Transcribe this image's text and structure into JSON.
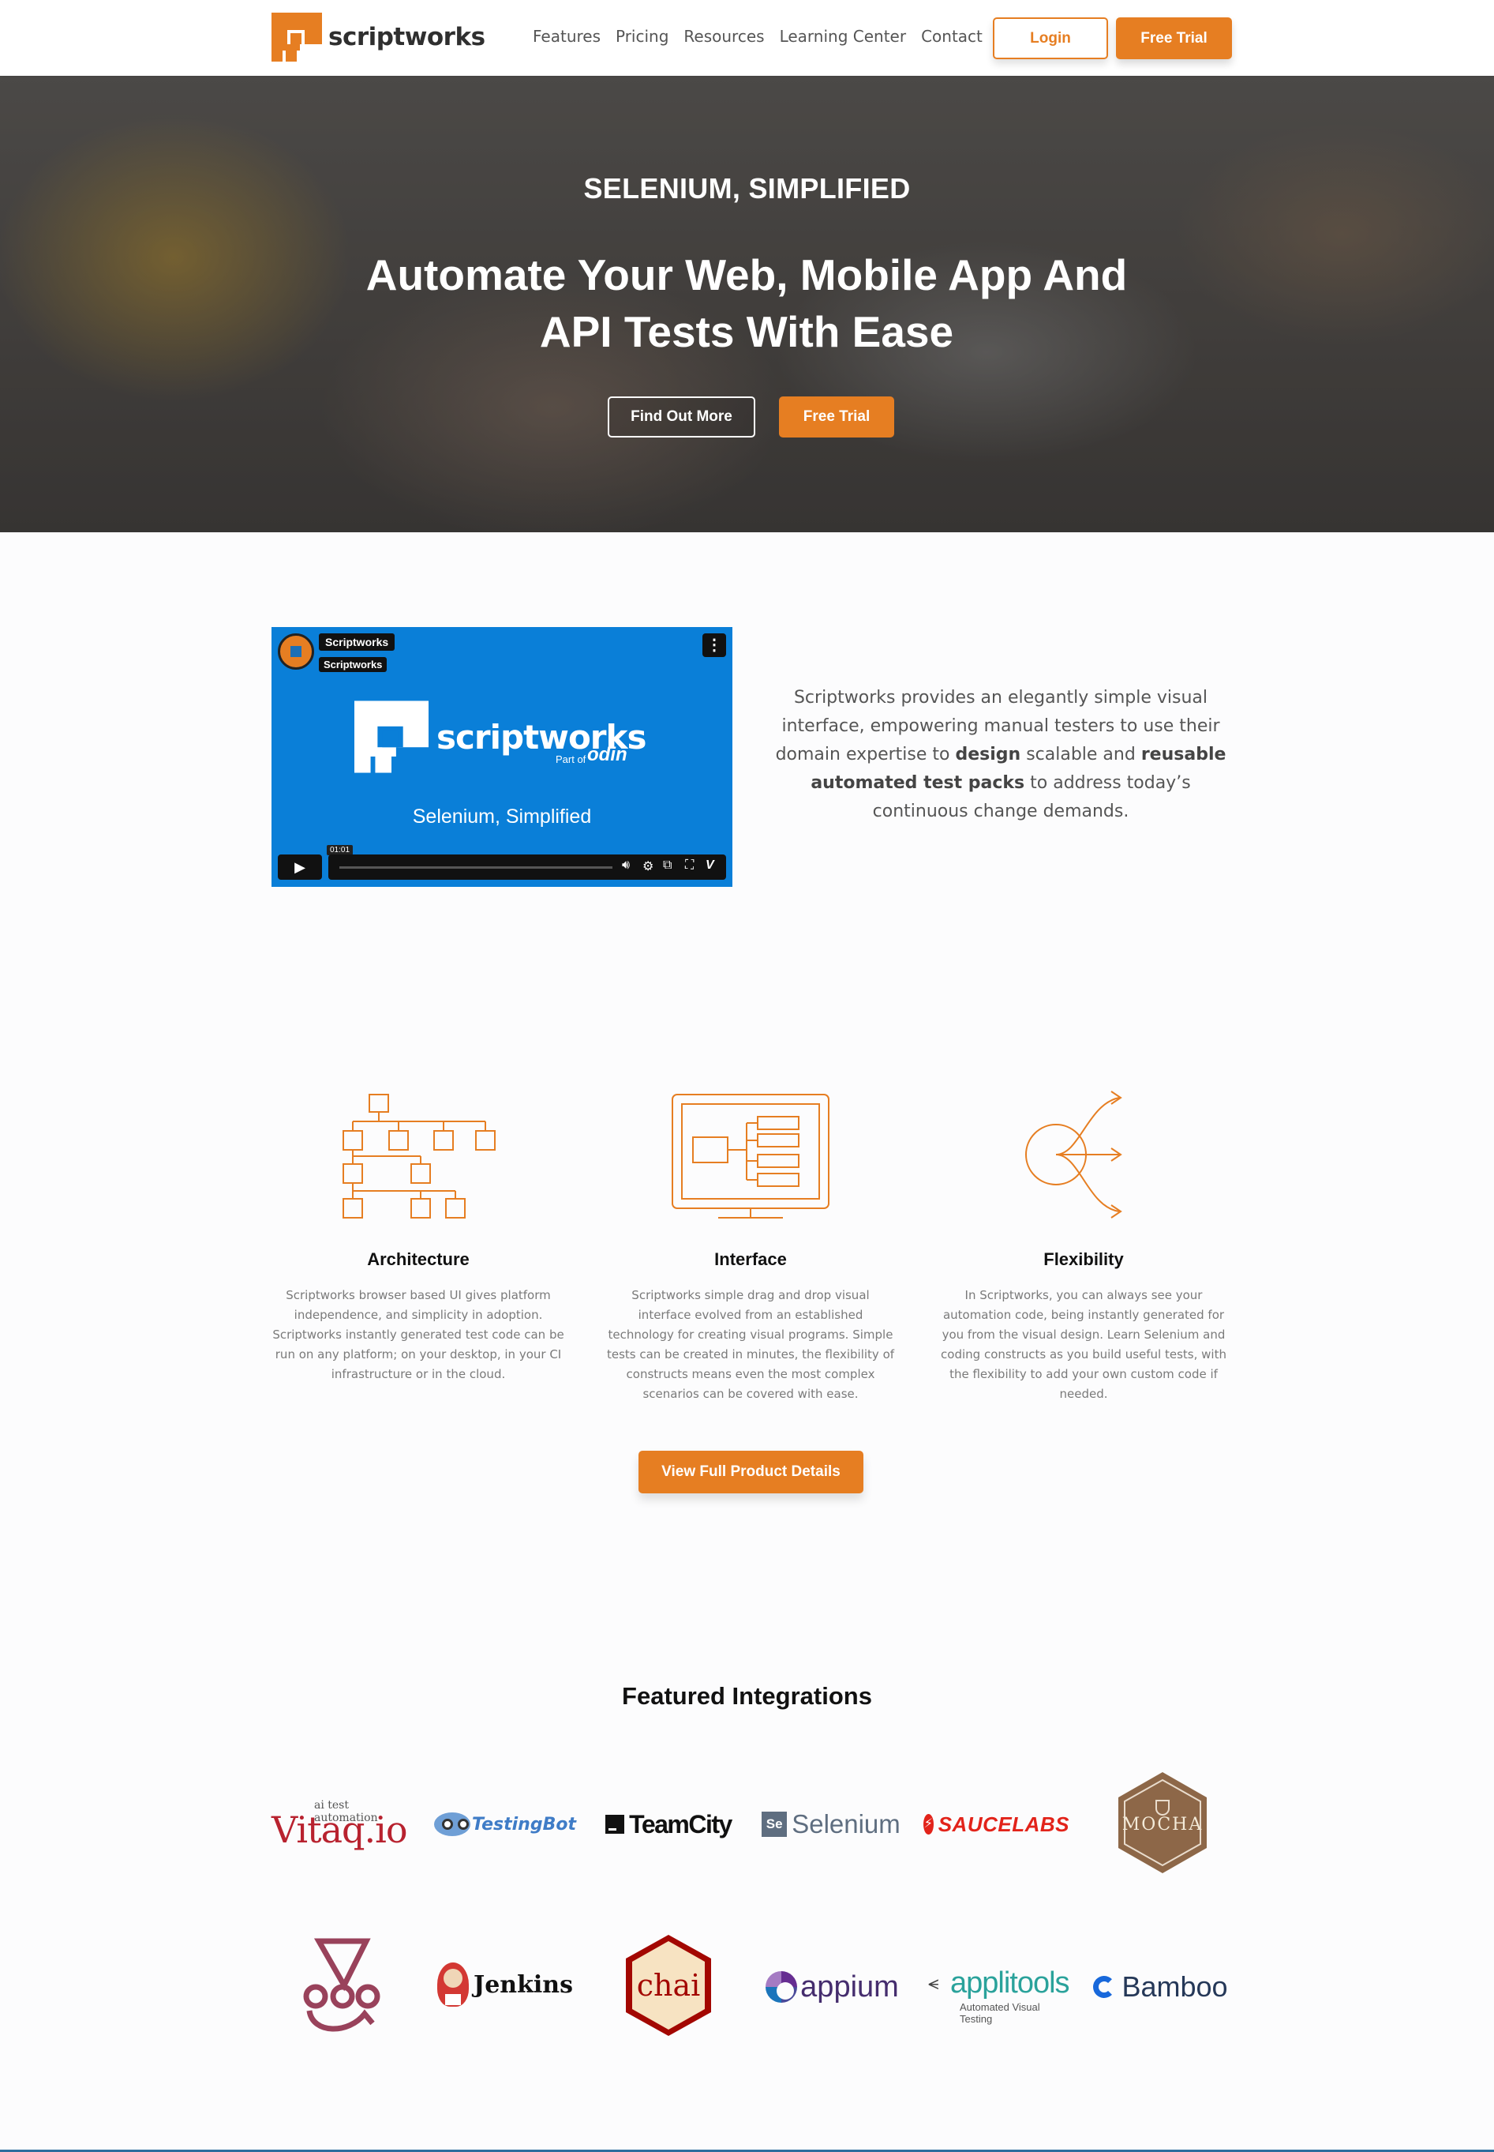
{
  "brand": {
    "name": "scriptworks",
    "accent": "#e67e22"
  },
  "nav": {
    "links": [
      "Features",
      "Pricing",
      "Resources",
      "Learning Center",
      "Contact"
    ],
    "login_label": "Login",
    "trial_label": "Free Trial"
  },
  "hero": {
    "kicker": "SELENIUM, SIMPLIFIED",
    "title": "Automate Your Web, Mobile App And API Tests With Ease",
    "find_out_label": "Find Out More",
    "trial_label": "Free Trial"
  },
  "video": {
    "channel_tag1": "Scriptworks",
    "channel_tag2": "Scriptworks",
    "logo_text": "scriptworks",
    "part_of": "Part of",
    "odin": "odin",
    "subtitle": "Selenium, Simplified",
    "timestamp": "01:01"
  },
  "intro": {
    "p1": "Scriptworks provides an elegantly simple visual interface, empowering manual testers to use their domain expertise to ",
    "b1": "design",
    "p2": " scalable and ",
    "b2": "reusable automated test packs",
    "p3": " to address today’s continuous change demands."
  },
  "features": [
    {
      "title": "Architecture",
      "icon": "hierarchy-icon",
      "desc": "Scriptworks browser based UI gives platform independence, and simplicity in adoption. Scriptworks instantly generated test code can be run on any platform; on your desktop, in your CI infrastructure or in the cloud."
    },
    {
      "title": "Interface",
      "icon": "monitor-icon",
      "desc": "Scriptworks simple drag and drop visual interface evolved from an established technology for creating visual programs. Simple tests can be created in minutes, the flexibility of constructs means even the most complex scenarios can be covered with ease."
    },
    {
      "title": "Flexibility",
      "icon": "branching-arrows-icon",
      "desc": "In Scriptworks, you can always see your automation code, being instantly generated for you from the visual design. Learn Selenium and coding constructs as you build useful tests, with the flexibility to add your own custom code if needed."
    }
  ],
  "details_label": "View Full Product Details",
  "integrations": {
    "title": "Featured Integrations",
    "vitaq": {
      "name": "Vitaq.io",
      "tagline": "ai test automation"
    },
    "testingbot": "TestingBot",
    "teamcity": "TeamCity",
    "selenium": "Selenium",
    "saucelabs": "SAUCELABS",
    "mocha": "MOCHA",
    "jest": "Jest",
    "jenkins": "Jenkins",
    "chai": "chai",
    "appium": "appium",
    "applitools": {
      "name": "applitools",
      "tagline": "Automated Visual Testing"
    },
    "bamboo": "Bamboo"
  }
}
